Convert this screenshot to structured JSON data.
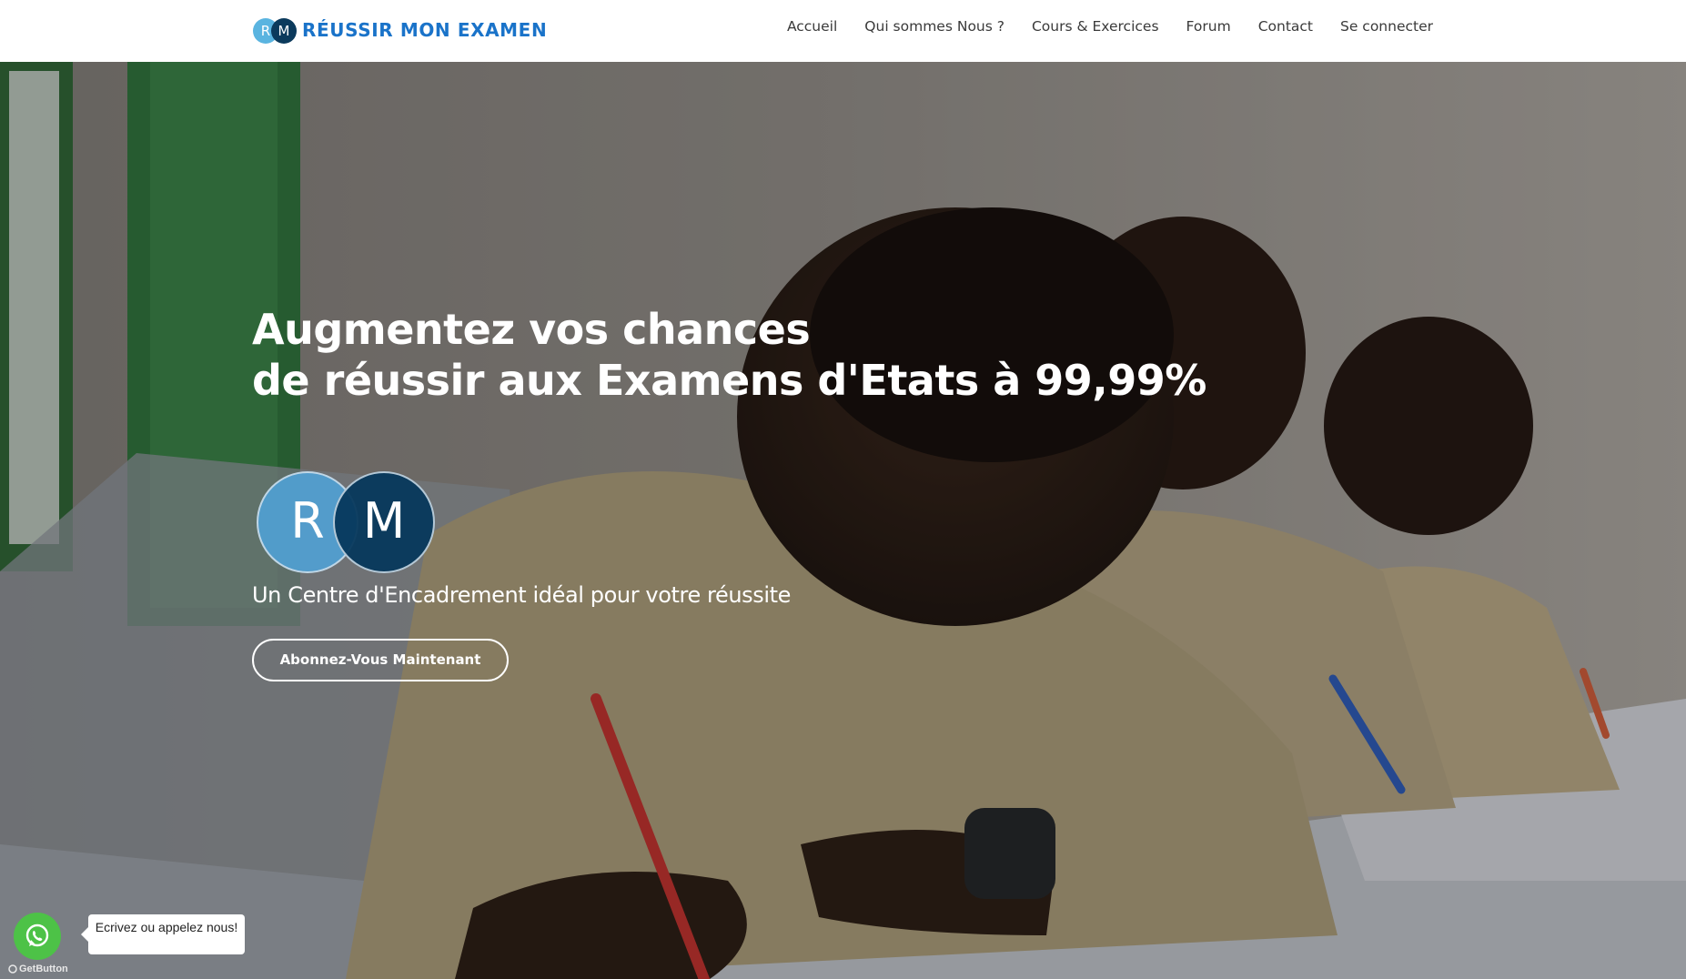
{
  "brand": {
    "logo_left": "R",
    "logo_right": "M",
    "name": "RÉUSSIR MON EXAMEN"
  },
  "nav": {
    "items": [
      {
        "label": "Accueil"
      },
      {
        "label": "Qui sommes Nous ?"
      },
      {
        "label": "Cours & Exercices"
      },
      {
        "label": "Forum"
      },
      {
        "label": "Contact"
      },
      {
        "label": "Se connecter"
      }
    ]
  },
  "hero": {
    "headline_line1": "Augmentez vos chances",
    "headline_line2": "de réussir aux Examens d'Etats à 99,99%",
    "logo_left": "R",
    "logo_right": "M",
    "subtitle": "Un Centre d'Encadrement idéal pour votre réussite",
    "cta_label": "Abonnez-Vous Maintenant",
    "background_icon": "students-writing-exam-photo"
  },
  "whatsapp": {
    "icon": "whatsapp-icon",
    "tooltip": "Ecrivez ou appelez nous!",
    "powered_by": "GetButton"
  },
  "colors": {
    "brand_blue": "#1a73c9",
    "logo_light": "#5ab4e0",
    "logo_dark": "#0b3a5c",
    "whatsapp_green": "#4dc247"
  }
}
